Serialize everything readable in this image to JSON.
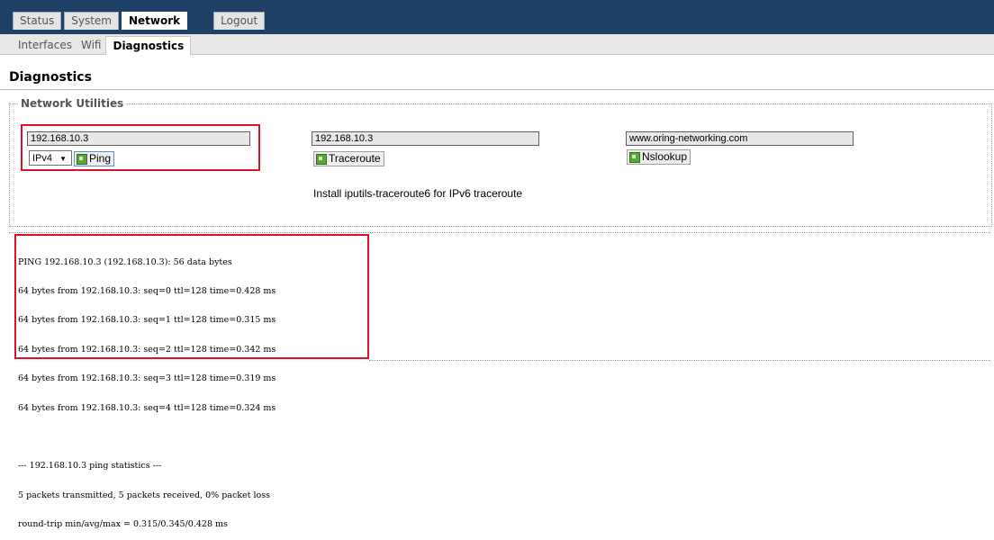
{
  "top_tabs": [
    "Status",
    "System",
    "Network",
    "Logout"
  ],
  "sub_tabs": [
    "Interfaces",
    "Wifi",
    "Diagnostics"
  ],
  "page_title": "Diagnostics",
  "legend": "Network Utilities",
  "ping": {
    "host": "192.168.10.3",
    "protocol": "IPv4",
    "button": "Ping"
  },
  "traceroute": {
    "host": "192.168.10.3",
    "button": "Traceroute",
    "hint": "Install iputils-traceroute6 for IPv6 traceroute"
  },
  "nslookup": {
    "host": "www.oring-networking.com",
    "button": "Nslookup"
  },
  "output_lines": [
    "PING 192.168.10.3 (192.168.10.3): 56 data bytes",
    "64 bytes from 192.168.10.3: seq=0 ttl=128 time=0.428 ms",
    "64 bytes from 192.168.10.3: seq=1 ttl=128 time=0.315 ms",
    "64 bytes from 192.168.10.3: seq=2 ttl=128 time=0.342 ms",
    "64 bytes from 192.168.10.3: seq=3 ttl=128 time=0.319 ms",
    "64 bytes from 192.168.10.3: seq=4 ttl=128 time=0.324 ms",
    "",
    "--- 192.168.10.3 ping statistics ---",
    "5 packets transmitted, 5 packets received, 0% packet loss",
    "round-trip min/avg/max = 0.315/0.345/0.428 ms"
  ],
  "colors": {
    "topbar": "#1e3f66",
    "highlight": "#e0102a",
    "button_icon": "#5aa53a"
  }
}
